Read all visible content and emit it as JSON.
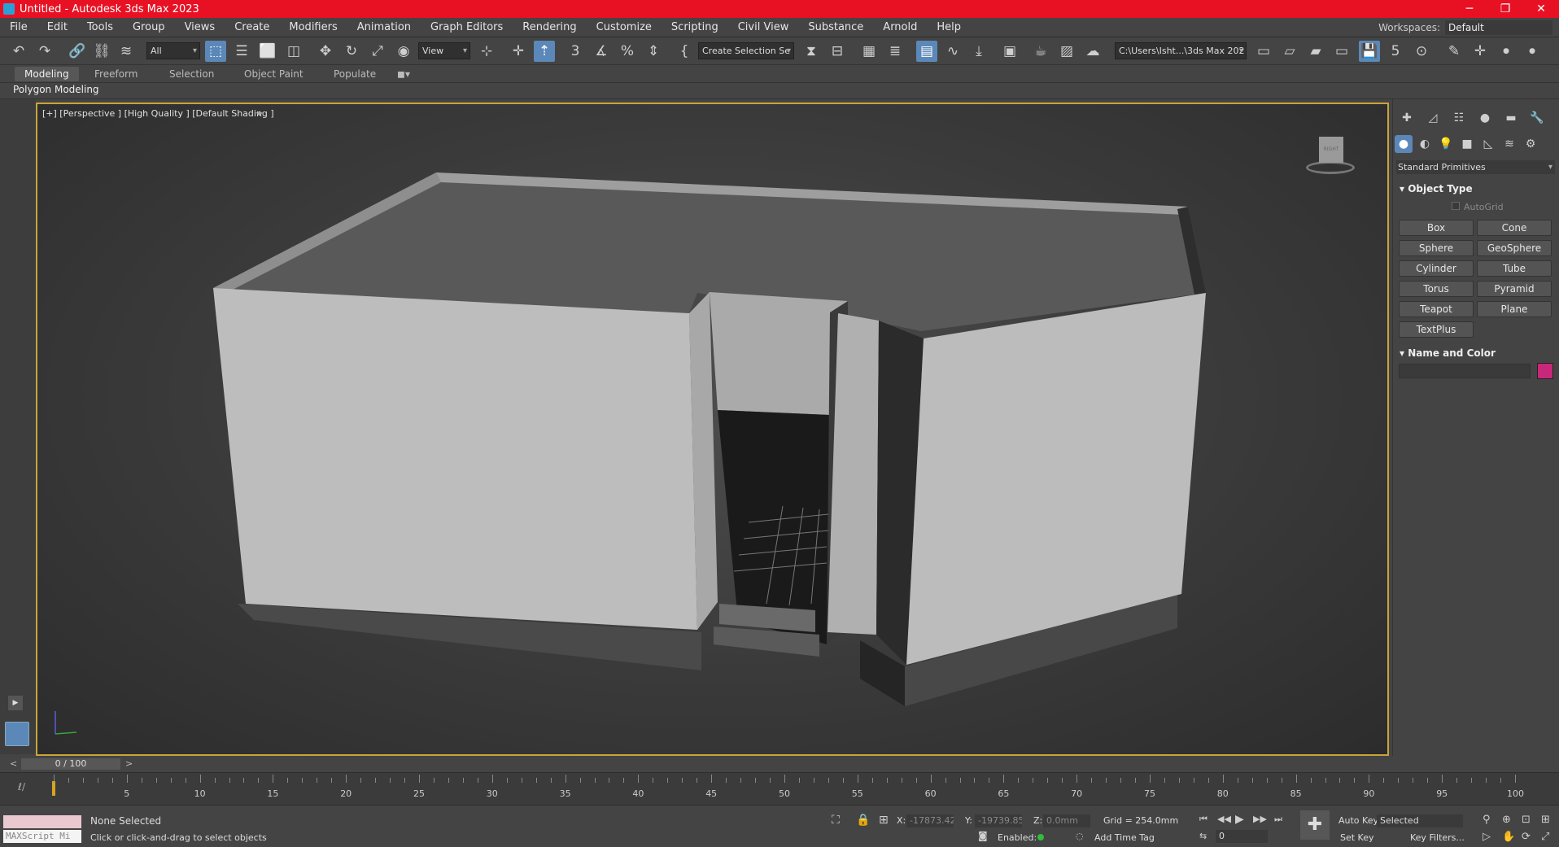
{
  "window": {
    "title": "Untitled - Autodesk 3ds Max 2023",
    "minimize": "─",
    "restore": "❐",
    "close": "✕"
  },
  "menu": [
    "File",
    "Edit",
    "Tools",
    "Group",
    "Views",
    "Create",
    "Modifiers",
    "Animation",
    "Graph Editors",
    "Rendering",
    "Customize",
    "Scripting",
    "Civil View",
    "Substance",
    "Arnold",
    "Help"
  ],
  "workspace": {
    "label": "Workspaces:",
    "value": "Default"
  },
  "toolbar": {
    "filter_value": "All",
    "refcoord_value": "View",
    "selection_set_value": "Create Selection Se",
    "project_path_value": "C:\\Users\\Isht...\\3ds Max 202",
    "snap_label": "3",
    "spinner_snap_label": "5"
  },
  "ribbon": {
    "tabs": [
      "Modeling",
      "Freeform",
      "Selection",
      "Object Paint",
      "Populate"
    ],
    "panel_label": "Polygon Modeling"
  },
  "viewport": {
    "label": "[+] [Perspective ] [High Quality ] [Default Shading ]",
    "viewcube_face": "RIGHT"
  },
  "command_panel": {
    "category_value": "Standard Primitives",
    "object_type_title": "Object Type",
    "autogrid_label": "AutoGrid",
    "buttons": [
      "Box",
      "Cone",
      "Sphere",
      "GeoSphere",
      "Cylinder",
      "Tube",
      "Torus",
      "Pyramid",
      "Teapot",
      "Plane",
      "TextPlus"
    ],
    "name_color_title": "Name and Color",
    "object_color": "#c8287a"
  },
  "timeline": {
    "slider_label": "0 / 100",
    "prev": "<",
    "next": ">",
    "ticks": [
      "5",
      "10",
      "15",
      "20",
      "25",
      "30",
      "35",
      "40",
      "45",
      "50",
      "55",
      "60",
      "65",
      "70",
      "75",
      "80",
      "85",
      "90",
      "95",
      "100"
    ]
  },
  "status": {
    "maxscript_placeholder": "MAXScript Mi",
    "selection": "None Selected",
    "prompt": "Click or click-and-drag to select objects",
    "x_label": "X:",
    "x_value": "-17873.42",
    "y_label": "Y:",
    "y_value": "-19739.85",
    "z_label": "Z:",
    "z_value": "0.0mm",
    "grid": "Grid = 254.0mm",
    "enabled_label": "Enabled:",
    "add_time_tag": "Add Time Tag",
    "auto_key": "Auto Key",
    "set_key": "Set Key",
    "key_mode_value": "Selected",
    "key_filters": "Key Filters...",
    "frame_value": "0"
  }
}
